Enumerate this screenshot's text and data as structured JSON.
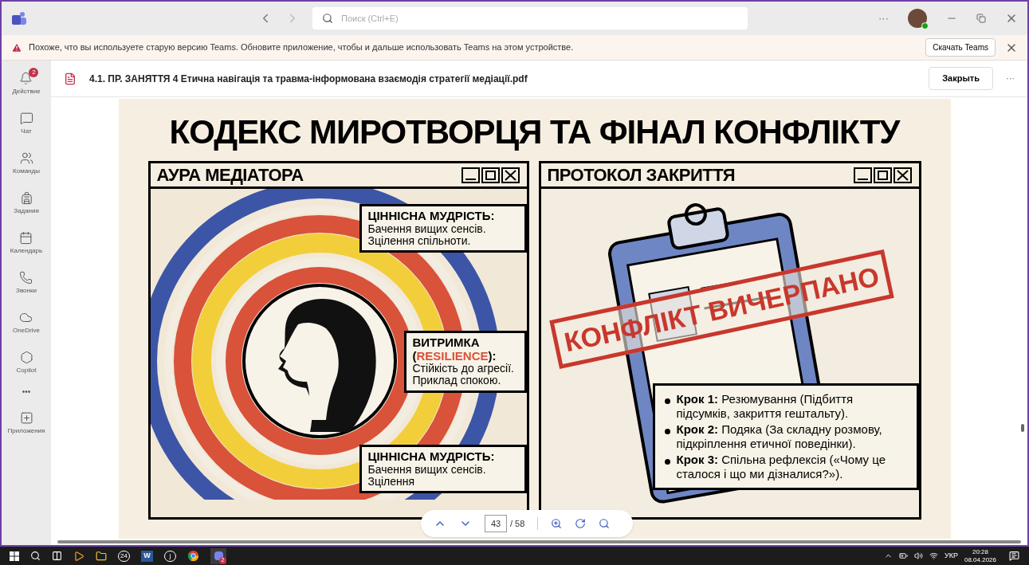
{
  "title_bar": {
    "search_placeholder": "Поиск (Ctrl+E)",
    "more": "···"
  },
  "banner": {
    "message": "Похоже, что вы используете старую версию Teams. Обновите приложение, чтобы и дальше использовать Teams на этом устройстве.",
    "button": "Скачать Teams"
  },
  "sidebar": {
    "items": [
      {
        "label": "Действие",
        "badge": "2"
      },
      {
        "label": "Чат"
      },
      {
        "label": "Команды"
      },
      {
        "label": "Задания"
      },
      {
        "label": "Календарь"
      },
      {
        "label": "Звонки"
      },
      {
        "label": "OneDrive"
      },
      {
        "label": "Copilot"
      }
    ],
    "more": "•••",
    "apps": "Приложения"
  },
  "document": {
    "file_name": "4.1. ПР. ЗАНЯТТЯ 4 Етична навігація та травма-інформована взаємодія стратегії медіації.pdf",
    "close_button": "Закрыть",
    "more": "···"
  },
  "page": {
    "title": "КОДЕКС МИРОТВОРЦЯ ТА ФІНАЛ КОНФЛІКТУ",
    "left_panel": {
      "title": "АУРА МЕДІАТОРА",
      "callouts": [
        {
          "title": [
            {
              "text": "ЦІННІСНА МУДРІСТЬ:"
            }
          ],
          "lines": [
            "Бачення вищих сенсів.",
            "Зцілення спільноти."
          ]
        },
        {
          "title": [
            {
              "text": "ВИТРИМКА ("
            },
            {
              "text": "RESILIENCE",
              "color": "#d9523a"
            },
            {
              "text": "):"
            }
          ],
          "lines": [
            "Стійкість до агресії.",
            "Приклад спокою."
          ]
        },
        {
          "title": [
            {
              "text": "ЦІННІСНА МУДРІСТЬ:"
            }
          ],
          "lines": [
            "Бачення вищих сенсів.",
            "Зцілення"
          ]
        }
      ]
    },
    "right_panel": {
      "title": "ПРОТОКОЛ ЗАКРИТТЯ",
      "stamp": "КОНФЛІКТ ВИЧЕРПАНО",
      "steps": [
        "**Крок 1:** Резюмування (Підбиття підсумків, закриття гештальту).",
        "**Крок 2:** Подяка (За складну розмову, підкріплення етичної поведінки).",
        "**Крок 3:** Спільна рефлексія («Чому це сталося і що ми дізналися?»)."
      ]
    }
  },
  "page_toolbar": {
    "page": "43",
    "total": "/ 58"
  },
  "taskbar": {
    "apps": [
      {
        "kind": "media"
      },
      {
        "kind": "folder"
      },
      {
        "kind": "app",
        "glyph": "24"
      },
      {
        "kind": "word",
        "glyph": "W"
      },
      {
        "kind": "app",
        "glyph": "j"
      },
      {
        "kind": "chrome"
      },
      {
        "kind": "teams",
        "badge": "2"
      }
    ],
    "language": "УКР",
    "time": "20:28",
    "date": "08.04.2026"
  }
}
